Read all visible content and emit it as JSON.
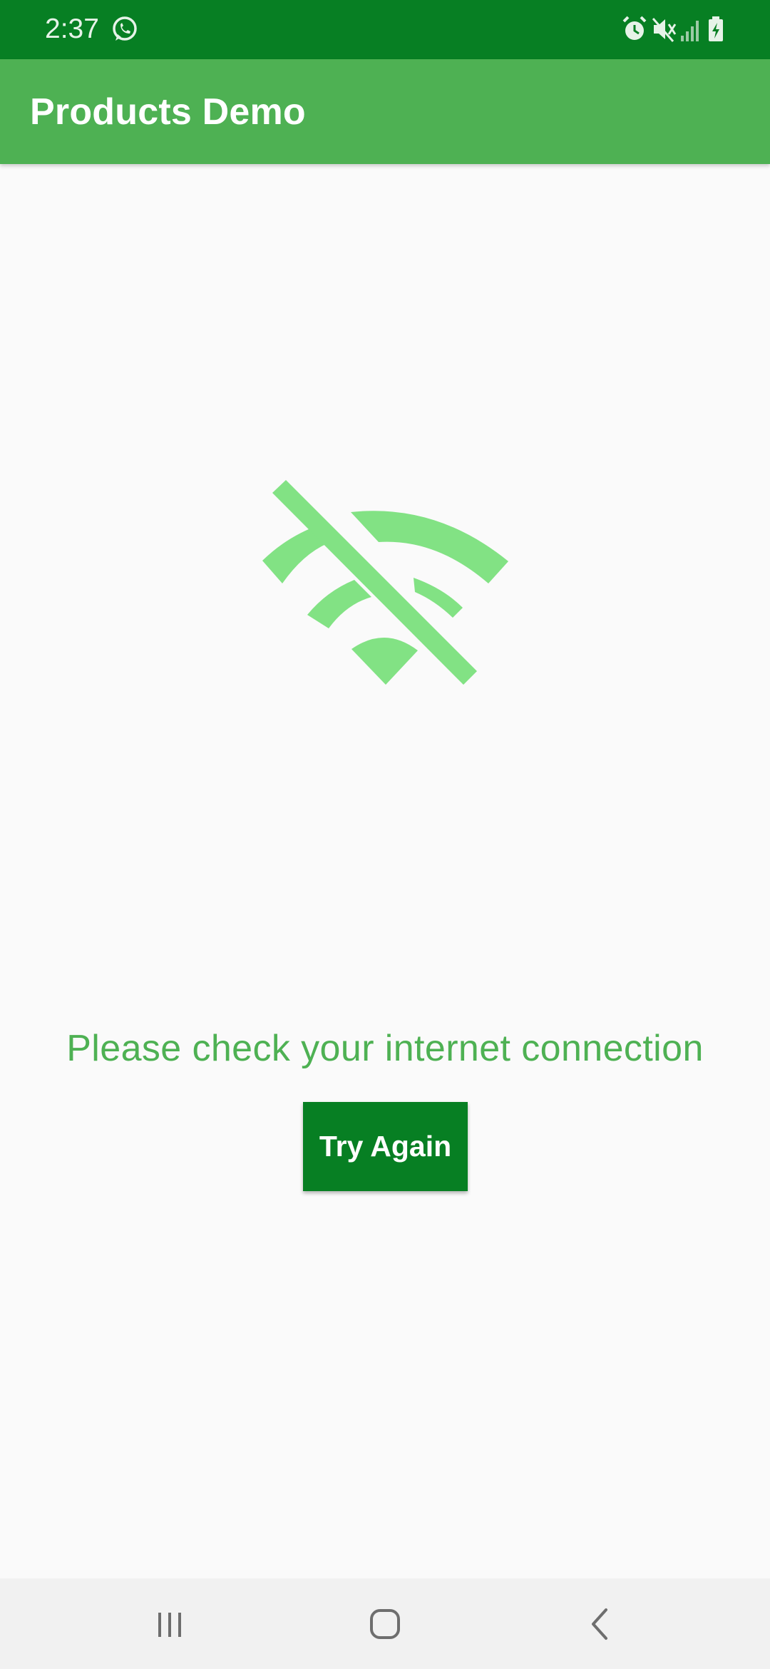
{
  "status_bar": {
    "time": "2:37",
    "icons": [
      "whatsapp-icon",
      "alarm-icon",
      "mute-icon",
      "signal-icon",
      "battery-charging-icon"
    ]
  },
  "app_bar": {
    "title": "Products Demo"
  },
  "empty_state": {
    "icon": "wifi-off-icon",
    "message": "Please check your internet connection",
    "button_label": "Try Again"
  },
  "nav_bar": {
    "buttons": [
      "recent-apps-icon",
      "home-icon",
      "back-icon"
    ]
  },
  "colors": {
    "status_bar": "#077f23",
    "app_bar": "#4eb153",
    "accent_text": "#4eb153",
    "icon_fill": "#82e284",
    "button": "#077f23",
    "background": "#fafafa",
    "nav_bar": "#f1f1f1"
  }
}
